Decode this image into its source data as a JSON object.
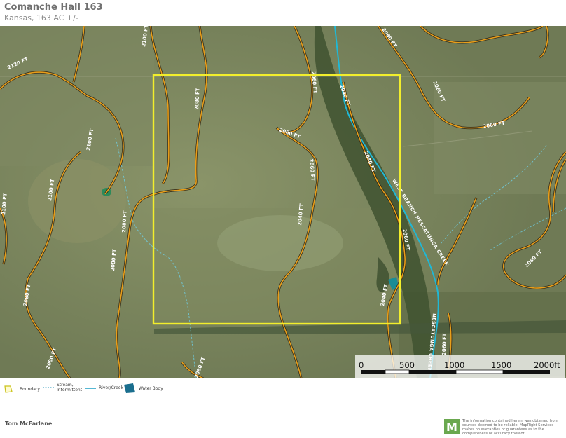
{
  "header": {
    "title": "Comanche Hall 163",
    "subtitle": "Kansas, 163 AC +/-"
  },
  "map": {
    "contour_labels": [
      "2080 FT",
      "2100 FT",
      "2120 FT",
      "2100 FT",
      "2100 FT",
      "2100 FT",
      "2080 FT",
      "2080 FT",
      "2080 FT",
      "2080 FT",
      "2080 FT",
      "2060 FT",
      "2060 FT",
      "2060 FT",
      "2040 FT",
      "2040 FT",
      "2060 FT",
      "2060 FT",
      "2060 FT",
      "2040 FT",
      "2060 FT",
      "2040 FT",
      "2060 FT",
      "2060 FT"
    ],
    "creek_label_1": "WEST BRANCH NESCATUNGA CREEK",
    "creek_label_2": "NESCATUNGA CREEK",
    "scale_bar": {
      "ticks": [
        "0",
        "500",
        "1000",
        "1500",
        "2000ft"
      ]
    },
    "colors": {
      "boundary": "#f2ee2c",
      "contour": "#f0a81c",
      "river": "#1fb8d6",
      "water_body": "#1a8c96"
    }
  },
  "legend": {
    "boundary": "Boundary",
    "stream": "Stream, Intermittent",
    "river": "River/Creek",
    "water_body": "Water Body"
  },
  "footer": {
    "author": "Tom McFarlane",
    "logo_letter": "M",
    "disclaimer": "The information contained herein was obtained from sources deemed to be reliable. MapRight Services makes no warranties or guarantees as to the completeness or accuracy thereof."
  }
}
